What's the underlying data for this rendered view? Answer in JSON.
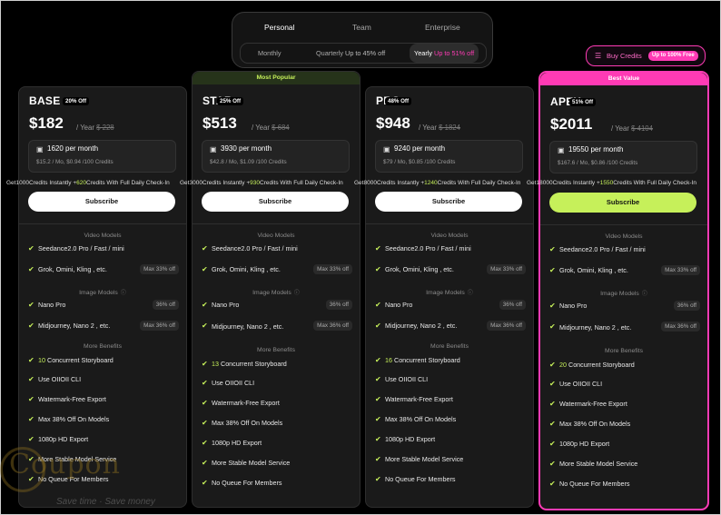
{
  "plan_tabs": [
    "Personal",
    "Team",
    "Enterprise"
  ],
  "active_plan_tab": "Personal",
  "periods": [
    {
      "label": "Monthly",
      "note": ""
    },
    {
      "label": "Quarterly",
      "note": "Up to 45% off"
    },
    {
      "label": "Yearly",
      "note": "Up to 51% off"
    }
  ],
  "active_period": "Yearly",
  "buy_credits": {
    "label": "Buy Credits",
    "tag": "Up to 100% Free",
    "icon": "layers-icon"
  },
  "badges": {
    "star": "Most Popular",
    "apex": "Best Value"
  },
  "colors": {
    "accent_lime": "#c6f05a",
    "accent_pink": "#ff3bb5",
    "card_bg": "#1a1a1a"
  },
  "section_labels": {
    "video": "Video Models",
    "image": "Image Models",
    "benefits": "More Benefits"
  },
  "subscribe_label": "Subscribe",
  "plans": [
    {
      "name": "BASE",
      "off": "20% Off",
      "price": "$182",
      "per": "/ Year",
      "old": "$ 228",
      "credits": "1620 per month",
      "credit_sub": "$15.2 / Mo, $0.94 /100 Credits",
      "line_pre": "Get",
      "line_base": "1000",
      "line_mid": "Credits Instantly +",
      "line_bonus": "620",
      "line_post": "Credits With Full Daily Check-In",
      "video": [
        {
          "text": "Seedance2.0 Pro / Fast / mini",
          "pill": ""
        },
        {
          "text": "Grok, Omini, Kling , etc.",
          "pill": "Max 33% off"
        }
      ],
      "image": [
        {
          "text": "Nano Pro",
          "pill": "36% off"
        },
        {
          "text": "Midjourney, Nano 2 , etc.",
          "pill": "Max 36% off"
        }
      ],
      "benefits": [
        {
          "num": "10",
          "text": " Concurrent Storyboard"
        },
        {
          "num": "",
          "text": "Use OIIOII CLI"
        },
        {
          "num": "",
          "text": "Watermark-Free Export"
        },
        {
          "num": "",
          "text": "Max 38% Off On Models"
        },
        {
          "num": "",
          "text": "1080p HD Export"
        },
        {
          "num": "",
          "text": "More Stable Model Service"
        },
        {
          "num": "",
          "text": "No Queue For Members"
        }
      ]
    },
    {
      "name": "STAR",
      "off": "25% Off",
      "price": "$513",
      "per": "/ Year",
      "old": "$ 684",
      "credits": "3930 per month",
      "credit_sub": "$42.8 / Mo, $1.09 /100 Credits",
      "line_pre": "Get",
      "line_base": "3000",
      "line_mid": "Credits Instantly +",
      "line_bonus": "930",
      "line_post": "Credits With Full Daily Check-In",
      "video": [
        {
          "text": "Seedance2.0 Pro / Fast / mini",
          "pill": ""
        },
        {
          "text": "Grok, Omini, Kling , etc.",
          "pill": "Max 33% off"
        }
      ],
      "image": [
        {
          "text": "Nano Pro",
          "pill": "36% off"
        },
        {
          "text": "Midjourney, Nano 2 , etc.",
          "pill": "Max 36% off"
        }
      ],
      "benefits": [
        {
          "num": "13",
          "text": " Concurrent Storyboard"
        },
        {
          "num": "",
          "text": "Use OIIOII CLI"
        },
        {
          "num": "",
          "text": "Watermark-Free Export"
        },
        {
          "num": "",
          "text": "Max 38% Off On Models"
        },
        {
          "num": "",
          "text": "1080p HD Export"
        },
        {
          "num": "",
          "text": "More Stable Model Service"
        },
        {
          "num": "",
          "text": "No Queue For Members"
        }
      ]
    },
    {
      "name": "PRO",
      "off": "48% Off",
      "price": "$948",
      "per": "/ Year",
      "old": "$ 1824",
      "credits": "9240 per month",
      "credit_sub": "$79 / Mo, $0.85 /100 Credits",
      "line_pre": "Get",
      "line_base": "8000",
      "line_mid": "Credits Instantly +",
      "line_bonus": "1240",
      "line_post": "Credits With Full Daily Check-In",
      "video": [
        {
          "text": "Seedance2.0 Pro / Fast / mini",
          "pill": ""
        },
        {
          "text": "Grok, Omini, Kling , etc.",
          "pill": "Max 33% off"
        }
      ],
      "image": [
        {
          "text": "Nano Pro",
          "pill": "36% off"
        },
        {
          "text": "Midjourney, Nano 2 , etc.",
          "pill": "Max 36% off"
        }
      ],
      "benefits": [
        {
          "num": "16",
          "text": " Concurrent Storyboard"
        },
        {
          "num": "",
          "text": "Use OIIOII CLI"
        },
        {
          "num": "",
          "text": "Watermark-Free Export"
        },
        {
          "num": "",
          "text": "Max 38% Off On Models"
        },
        {
          "num": "",
          "text": "1080p HD Export"
        },
        {
          "num": "",
          "text": "More Stable Model Service"
        },
        {
          "num": "",
          "text": "No Queue For Members"
        }
      ]
    },
    {
      "name": "APEX",
      "off": "51% Off",
      "price": "$2011",
      "per": "/ Year",
      "old": "$ 4104",
      "credits": "19550 per month",
      "credit_sub": "$167.6 / Mo, $0.86 /100 Credits",
      "line_pre": "Get",
      "line_base": "18000",
      "line_mid": "Credits Instantly +",
      "line_bonus": "1550",
      "line_post": "Credits With Full Daily Check-In",
      "video": [
        {
          "text": "Seedance2.0 Pro / Fast / mini",
          "pill": ""
        },
        {
          "text": "Grok, Omini, Kling , etc.",
          "pill": "Max 33% off"
        }
      ],
      "image": [
        {
          "text": "Nano Pro",
          "pill": "36% off"
        },
        {
          "text": "Midjourney, Nano 2 , etc.",
          "pill": "Max 36% off"
        }
      ],
      "benefits": [
        {
          "num": "20",
          "text": " Concurrent Storyboard"
        },
        {
          "num": "",
          "text": "Use OIIOII CLI"
        },
        {
          "num": "",
          "text": "Watermark-Free Export"
        },
        {
          "num": "",
          "text": "Max 38% Off On Models"
        },
        {
          "num": "",
          "text": "1080p HD Export"
        },
        {
          "num": "",
          "text": "More Stable Model Service"
        },
        {
          "num": "",
          "text": "No Queue For Members"
        }
      ]
    }
  ],
  "watermark": {
    "logo": "Coupon",
    "tagline": "Save time · Save money"
  }
}
